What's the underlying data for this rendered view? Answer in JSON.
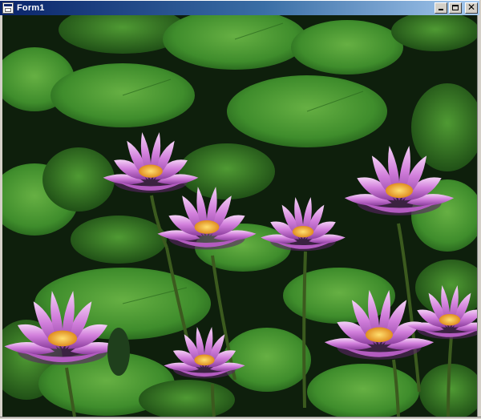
{
  "window": {
    "title": "Form1",
    "app_icon": "form-window-icon",
    "buttons": {
      "minimize_icon": "minimize-icon",
      "maximize_icon": "maximize-icon",
      "close_icon": "close-icon"
    }
  },
  "content": {
    "image_subject": "water-lilies-photo",
    "colors": {
      "titlebar_start": "#0a246a",
      "titlebar_end": "#a6caf0",
      "pad_green": "#3d8a2a",
      "petal_pink": "#c06ad0"
    }
  }
}
